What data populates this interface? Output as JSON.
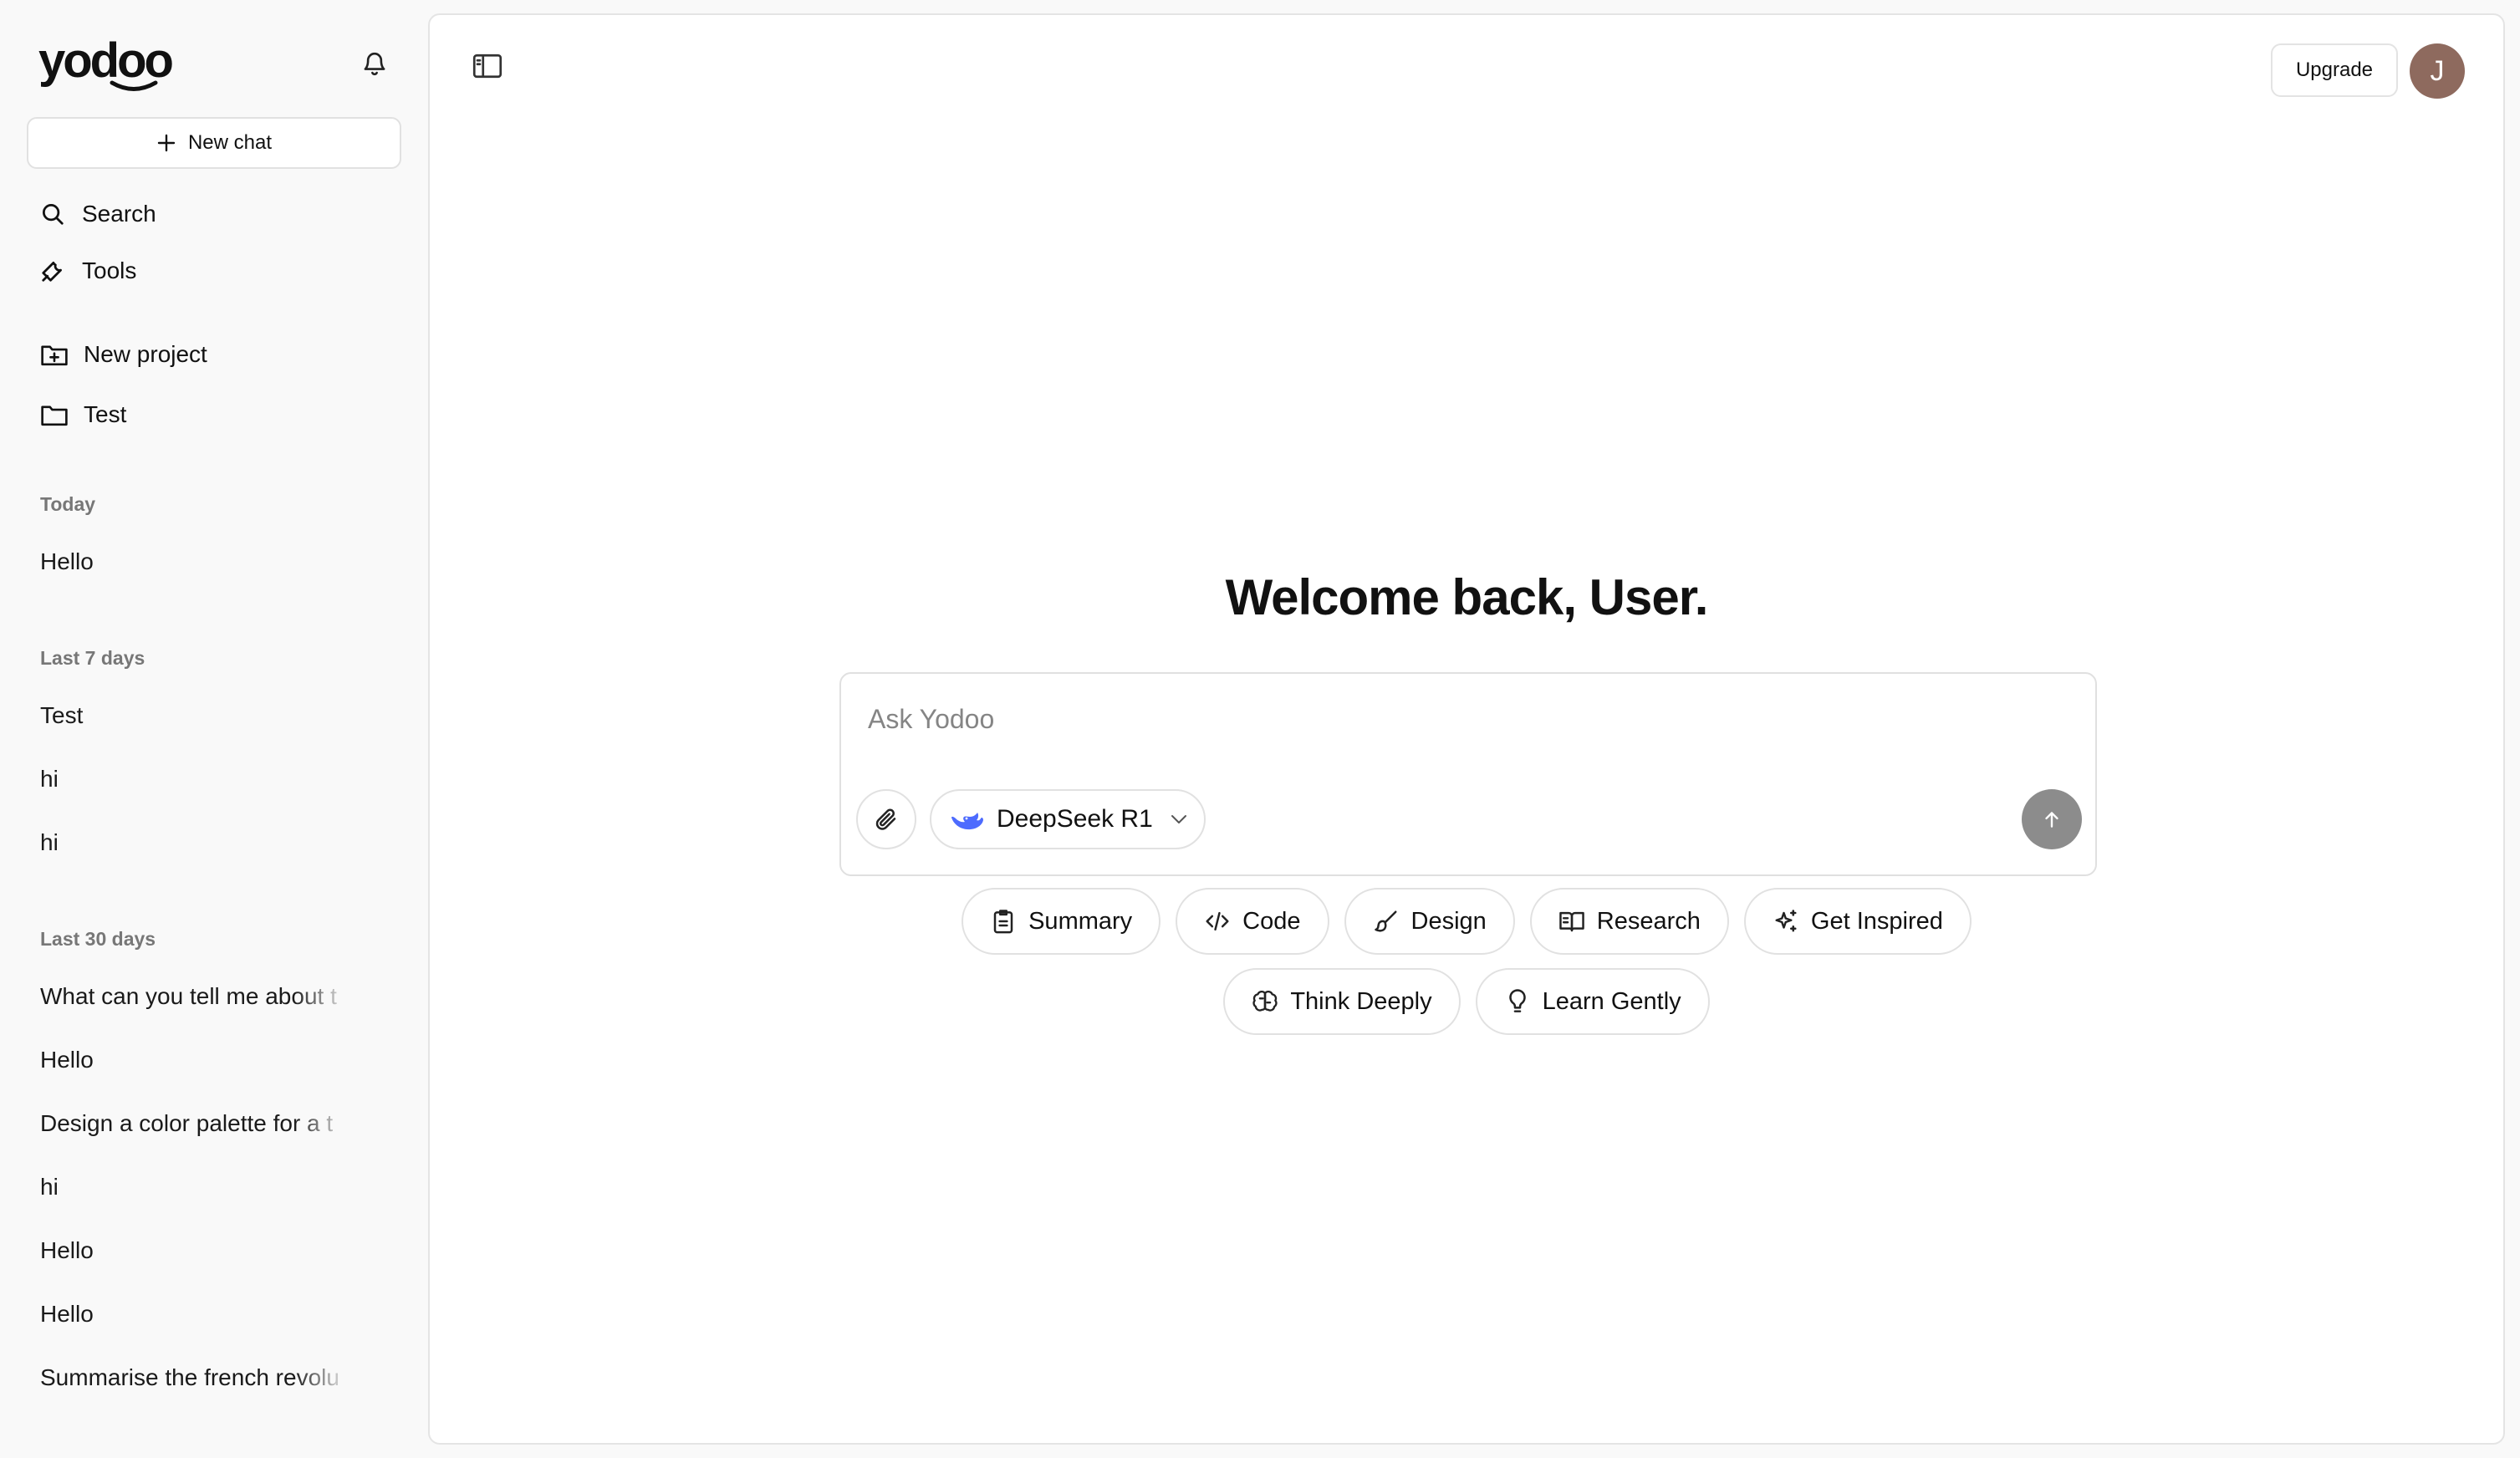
{
  "brand": {
    "logo_text": "yodoo"
  },
  "sidebar": {
    "new_chat_label": "New chat",
    "nav": [
      {
        "label": "Search",
        "icon": "search-icon"
      },
      {
        "label": "Tools",
        "icon": "wrench-icon"
      }
    ],
    "projects": [
      {
        "label": "New project",
        "icon": "folder-plus-icon"
      },
      {
        "label": "Test",
        "icon": "folder-icon"
      }
    ],
    "sections": [
      {
        "label": "Today",
        "items": [
          "Hello"
        ]
      },
      {
        "label": "Last 7 days",
        "items": [
          "Test",
          "hi",
          "hi"
        ]
      },
      {
        "label": "Last 30 days",
        "items": [
          "What can you tell me about t",
          "Hello",
          "Design a color palette for a t",
          "hi",
          "Hello",
          "Hello",
          "Summarise the french revolu"
        ]
      }
    ]
  },
  "header": {
    "upgrade_label": "Upgrade",
    "avatar_initial": "J"
  },
  "main": {
    "welcome": "Welcome back, User.",
    "composer": {
      "placeholder": "Ask Yodoo",
      "model_name": "DeepSeek R1",
      "model_icon": "whale-icon"
    },
    "chips_row1": [
      {
        "label": "Summary",
        "icon": "clipboard-icon"
      },
      {
        "label": "Code",
        "icon": "code-icon"
      },
      {
        "label": "Design",
        "icon": "brush-icon"
      },
      {
        "label": "Research",
        "icon": "book-icon"
      },
      {
        "label": "Get Inspired",
        "icon": "sparkle-icon"
      }
    ],
    "chips_row2": [
      {
        "label": "Think Deeply",
        "icon": "brain-icon"
      },
      {
        "label": "Learn Gently",
        "icon": "lightbulb-icon"
      }
    ]
  },
  "colors": {
    "accent_send": "#8c8c8c",
    "avatar_bg": "#8e6a5e",
    "model_icon": "#4d6bfe"
  }
}
